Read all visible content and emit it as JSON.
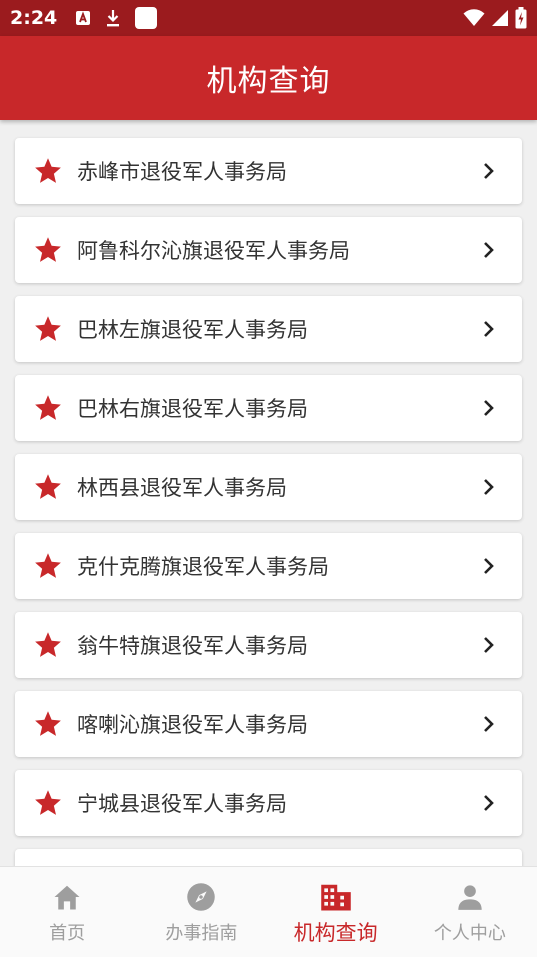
{
  "status_bar": {
    "time": "2:24"
  },
  "app_bar": {
    "title": "机构查询"
  },
  "colors": {
    "primary": "#c8282a",
    "status_bar": "#9b1b1e",
    "inactive": "#9e9e9e"
  },
  "institutions": [
    {
      "name": "赤峰市退役军人事务局",
      "icon": "star-icon"
    },
    {
      "name": "阿鲁科尔沁旗退役军人事务局",
      "icon": "star-icon"
    },
    {
      "name": "巴林左旗退役军人事务局",
      "icon": "star-icon"
    },
    {
      "name": "巴林右旗退役军人事务局",
      "icon": "star-icon"
    },
    {
      "name": "林西县退役军人事务局",
      "icon": "star-icon"
    },
    {
      "name": "克什克腾旗退役军人事务局",
      "icon": "star-icon"
    },
    {
      "name": "翁牛特旗退役军人事务局",
      "icon": "star-icon"
    },
    {
      "name": "喀喇沁旗退役军人事务局",
      "icon": "star-icon"
    },
    {
      "name": "宁城县退役军人事务局",
      "icon": "star-icon"
    }
  ],
  "bottom_nav": {
    "home": {
      "label": "首页",
      "icon": "home-icon"
    },
    "guide": {
      "label": "办事指南",
      "icon": "compass-icon"
    },
    "org": {
      "label": "机构查询",
      "icon": "building-icon",
      "active": true
    },
    "profile": {
      "label": "个人中心",
      "icon": "person-icon"
    }
  }
}
